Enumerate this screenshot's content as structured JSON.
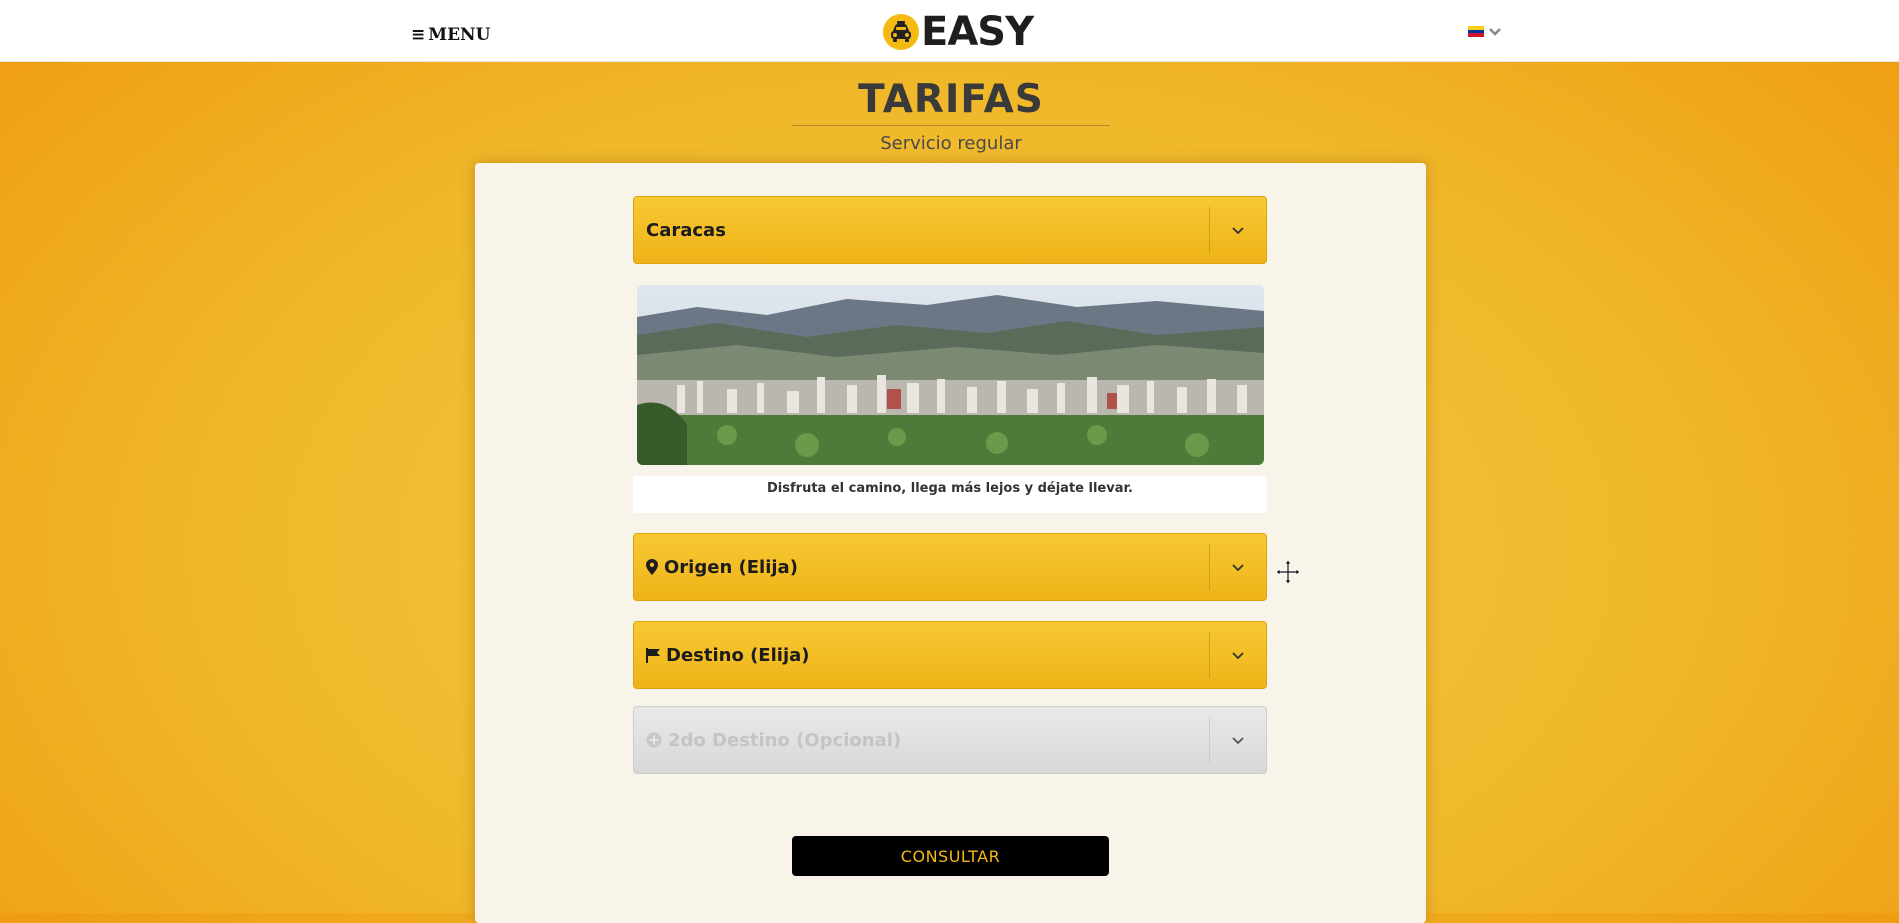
{
  "header": {
    "menu_label": "MENU",
    "logo_text": "EASY"
  },
  "page": {
    "title": "TARIFAS",
    "subtitle": "Servicio regular"
  },
  "form": {
    "city_selected": "Caracas",
    "caption": "Disfruta el camino, llega más lejos y déjate llevar.",
    "origin_label": "Origen (Elija)",
    "destination_label": "Destino (Elija)",
    "second_destination_label": "2do Destino (Opcional)",
    "submit_label": "CONSULTAR"
  },
  "colors": {
    "accent_yellow": "#f5b914",
    "button_black": "#000000",
    "flag": [
      "#f7d117",
      "#0033a0",
      "#cf142b"
    ]
  },
  "icons": {
    "menu": "bars-icon",
    "language_caret": "chevron-down-icon",
    "origin": "map-pin-icon",
    "destination": "flag-icon",
    "second_destination": "plus-circle-icon",
    "cursor": "move-cursor-icon"
  }
}
